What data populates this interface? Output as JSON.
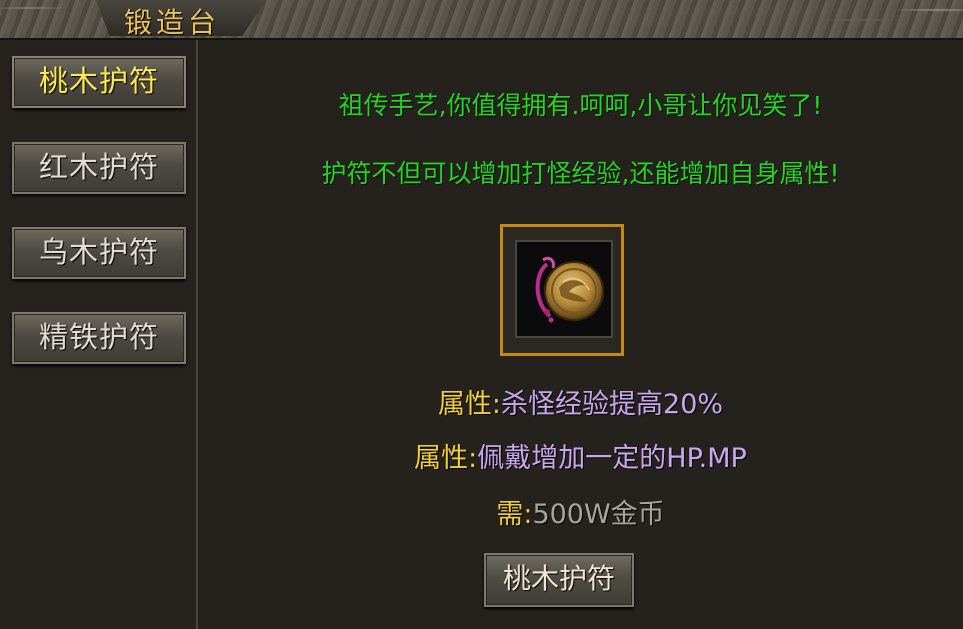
{
  "window": {
    "title": "锻造台"
  },
  "sidebar": {
    "items": [
      {
        "label": "桃木护符",
        "active": true
      },
      {
        "label": "红木护符",
        "active": false
      },
      {
        "label": "乌木护符",
        "active": false
      },
      {
        "label": "精铁护符",
        "active": false
      }
    ]
  },
  "main": {
    "line1": "祖传手艺,你值得拥有.呵呵,小哥让你见笑了!",
    "line2": "护符不但可以增加打怪经验,还能增加自身属性!",
    "item_icon": "amulet-icon",
    "stats": [
      {
        "label": "属性:",
        "value": "杀怪经验提高20%"
      },
      {
        "label": "属性:",
        "value": "佩戴增加一定的HP.MP"
      }
    ],
    "cost": {
      "label": "需:",
      "value": "500W金币"
    },
    "forge_button": "桃木护符"
  },
  "colors": {
    "accent_gold": "#e8c25a",
    "active_tab_text": "#ffe84a",
    "dialog_green": "#22d61e",
    "stat_label": "#f1cf2e",
    "stat_value": "#c9a6ee",
    "cost_value": "#a9a49a",
    "item_frame": "#c48a14"
  }
}
